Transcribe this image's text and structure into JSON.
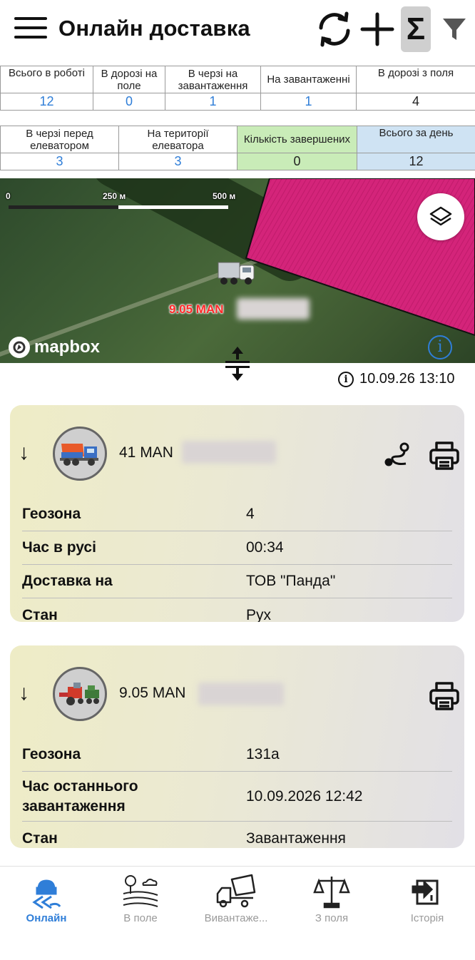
{
  "header": {
    "title": "Онлайн доставка",
    "sum_symbol": "Σ"
  },
  "stats_row1": {
    "headers": [
      "Всього в роботі",
      "В дорозі на поле",
      "В черзі на завантаження",
      "На завантаженні",
      "В дорозі з поля"
    ],
    "values": [
      "12",
      "0",
      "1",
      "1",
      "4"
    ]
  },
  "stats_row2": {
    "headers": [
      "В черзі перед елеватором",
      "На території елеватора",
      "Кількість завершених",
      "Всього за день"
    ],
    "values": [
      "3",
      "3",
      "0",
      "12"
    ]
  },
  "map": {
    "scale_labels": [
      "0",
      "250 м",
      "500 м"
    ],
    "truck_label": "9.05 MAN",
    "attribution": "mapbox",
    "info_glyph": "i",
    "field_color": "#d4247a"
  },
  "timestamp": "10.09.26 13:10",
  "cards": [
    {
      "name": "41 MAN",
      "rows": [
        {
          "label": "Геозона",
          "value": "4"
        },
        {
          "label": "Час в русі",
          "value": "00:34"
        },
        {
          "label": "Доставка на",
          "value": "ТОВ \"Панда\""
        },
        {
          "label": "Стан",
          "value": "Рух"
        }
      ]
    },
    {
      "name": "9.05 MAN",
      "rows": [
        {
          "label": "Геозона",
          "value": "131a"
        },
        {
          "label": "Час останнього завантаження",
          "value": "10.09.2026 12:42"
        },
        {
          "label": "Стан",
          "value": "Завантаження"
        }
      ]
    }
  ],
  "nav": {
    "items": [
      "Онлайн",
      "В поле",
      "Вивантаже...",
      "З поля",
      "Історія"
    ],
    "active_color": "#2f7ed8"
  }
}
